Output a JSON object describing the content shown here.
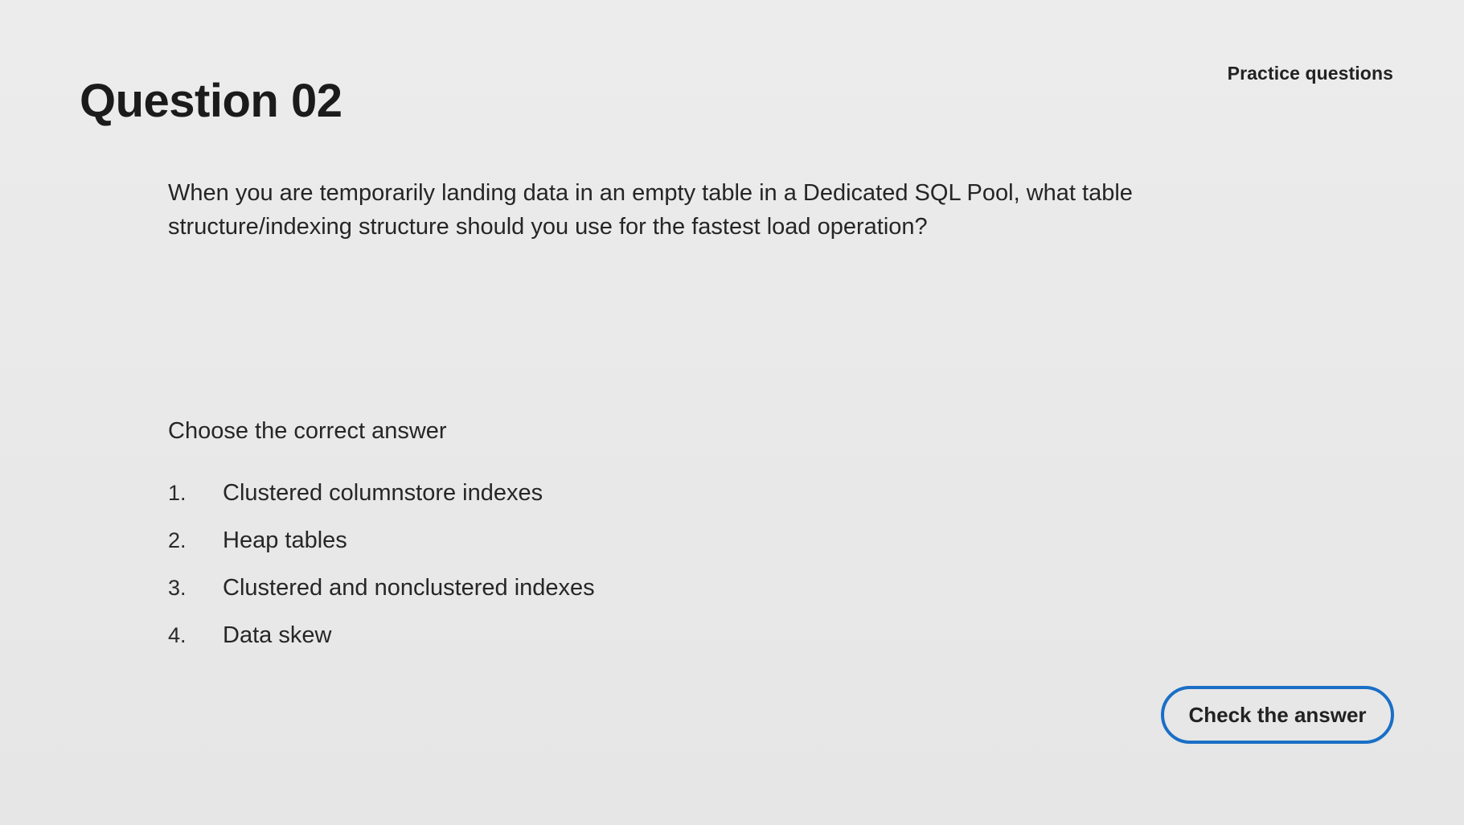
{
  "header": {
    "section_label": "Practice questions",
    "title": "Question 02"
  },
  "question": {
    "text": "When you are temporarily landing data in an empty table in a Dedicated SQL Pool, what table structure/indexing structure should you use for the fastest load operation?"
  },
  "answers": {
    "prompt": "Choose the correct answer",
    "options": [
      {
        "number": "1.",
        "label": "Clustered columnstore indexes"
      },
      {
        "number": "2.",
        "label": "Heap tables"
      },
      {
        "number": "3.",
        "label": "Clustered and nonclustered indexes"
      },
      {
        "number": "4.",
        "label": "Data skew"
      }
    ]
  },
  "actions": {
    "check_label": "Check the answer"
  },
  "colors": {
    "accent": "#1a6fc6",
    "background": "#e9e9e9",
    "text": "#1f1f1f"
  }
}
